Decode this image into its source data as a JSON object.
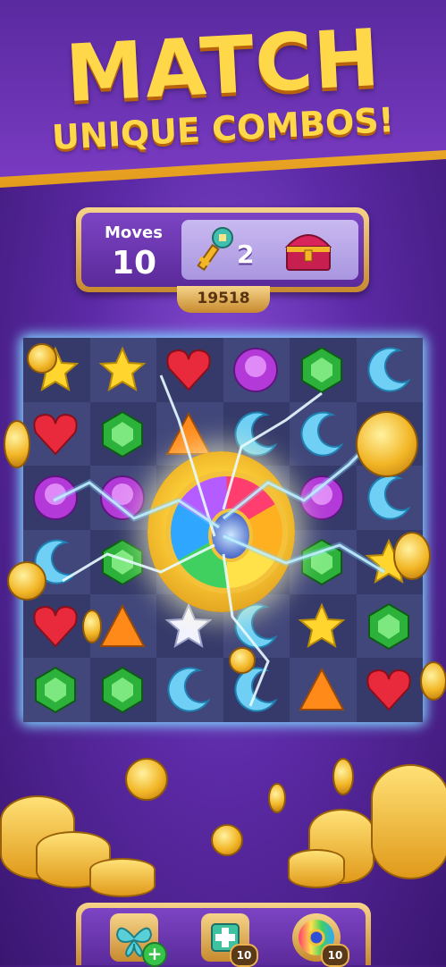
{
  "banner": {
    "title": "MATCH",
    "subtitle": "UNIQUE COMBOS!"
  },
  "hud": {
    "moves_label": "Moves",
    "moves_value": "10",
    "goal_key_count": "2",
    "goal_key_icon": "key-icon",
    "goal_chest_icon": "treasure-chest-icon",
    "score": "19518"
  },
  "board": {
    "rows": [
      [
        "yellow-star",
        "yellow-star",
        "red-heart",
        "purple-gem",
        "green-gem",
        "blue-moon"
      ],
      [
        "red-heart",
        "green-gem",
        "orange-triangle",
        "blue-moon",
        "blue-moon",
        "coin"
      ],
      [
        "purple-gem",
        "purple-gem",
        "rainbow-bomb",
        "rainbow-bomb",
        "purple-gem",
        "blue-moon"
      ],
      [
        "blue-moon",
        "green-gem",
        "rainbow-bomb",
        "rainbow-bomb",
        "green-gem",
        "yellow-star"
      ],
      [
        "red-heart",
        "orange-triangle",
        "white-star",
        "blue-moon",
        "yellow-star",
        "green-gem"
      ],
      [
        "green-gem",
        "green-gem",
        "blue-moon",
        "blue-moon",
        "orange-triangle",
        "red-heart"
      ]
    ],
    "special_icon": "rainbow-bomb-icon"
  },
  "boosters": [
    {
      "icon": "butterfly-booster-icon",
      "badge": "+"
    },
    {
      "icon": "hammer-booster-icon",
      "badge": "10"
    },
    {
      "icon": "rainbow-booster-icon",
      "badge": "10"
    }
  ],
  "colors": {
    "gold": "#ffd84a",
    "purple": "#5c2aa6",
    "board": "#2c2f5a",
    "glow": "#7fd8ff"
  }
}
